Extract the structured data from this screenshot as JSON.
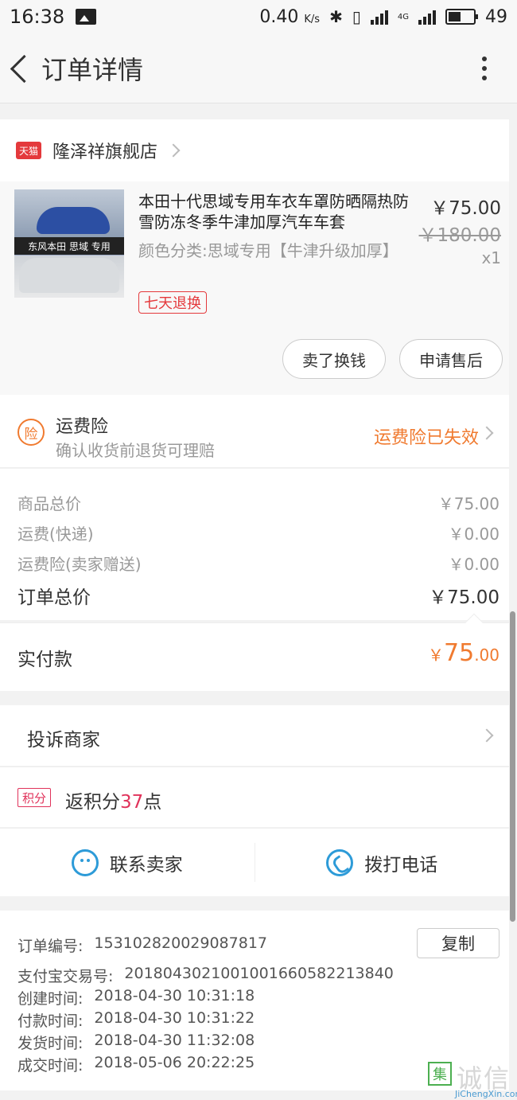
{
  "status_bar": {
    "time": "16:38",
    "speed": "0.40",
    "speed_unit": "K/s",
    "network": "4G",
    "battery": "49"
  },
  "header": {
    "title": "订单详情"
  },
  "shop": {
    "badge": "天猫",
    "name": "隆泽祥旗舰店"
  },
  "product": {
    "title": "本田十代思域专用车衣车罩防晒隔热防雪防冻冬季牛津加厚汽车车套",
    "spec": "颜色分类:思域专用【牛津升级加厚】",
    "service_badge": "七天退换",
    "image_banner": "东风本田 思域 专用",
    "price": "￥75.00",
    "original_price": "￥180.00",
    "quantity": "x1",
    "buttons": {
      "sell": "卖了换钱",
      "after_sales": "申请售后"
    }
  },
  "insurance": {
    "icon_char": "险",
    "title": "运费险",
    "subtitle": "确认收货前退货可理赔",
    "status": "运费险已失效"
  },
  "summary": {
    "rows": [
      {
        "label": "商品总价",
        "value": "￥75.00"
      },
      {
        "label": "运费(快递)",
        "value": "￥0.00"
      },
      {
        "label": "运费险(卖家赠送)",
        "value": "￥0.00"
      }
    ],
    "total_label": "订单总价",
    "total_value": "￥75.00"
  },
  "paid": {
    "label": "实付款",
    "currency": "￥",
    "integer": "75",
    "decimal": ".00"
  },
  "complain": {
    "label": "投诉商家"
  },
  "points": {
    "badge": "积分",
    "prefix": "返积分",
    "value": "37",
    "suffix": "点"
  },
  "contact": {
    "seller": "联系卖家",
    "phone": "拨打电话"
  },
  "order_info": {
    "copy_label": "复制",
    "rows": [
      {
        "label": "订单编号:",
        "value": "153102820029087817"
      },
      {
        "label": "支付宝交易号:",
        "value": "2018043021001001660582213840"
      },
      {
        "label": "创建时间:",
        "value": "2018-04-30 10:31:18"
      },
      {
        "label": "付款时间:",
        "value": "2018-04-30 10:31:22"
      },
      {
        "label": "发货时间:",
        "value": "2018-04-30 11:32:08"
      },
      {
        "label": "成交时间:",
        "value": "2018-05-06 20:22:25"
      }
    ]
  },
  "watermark": {
    "logo_char": "集",
    "text": "诚信",
    "domain": "JiChengXin.com"
  },
  "colors": {
    "orange": "#f07a2f",
    "red": "#e4393c",
    "pink": "#e0325a",
    "blue": "#2d9bd8"
  },
  "icons": [
    "back-arrow-icon",
    "more-icon",
    "chevron-right-icon",
    "chat-icon",
    "phone-icon"
  ]
}
